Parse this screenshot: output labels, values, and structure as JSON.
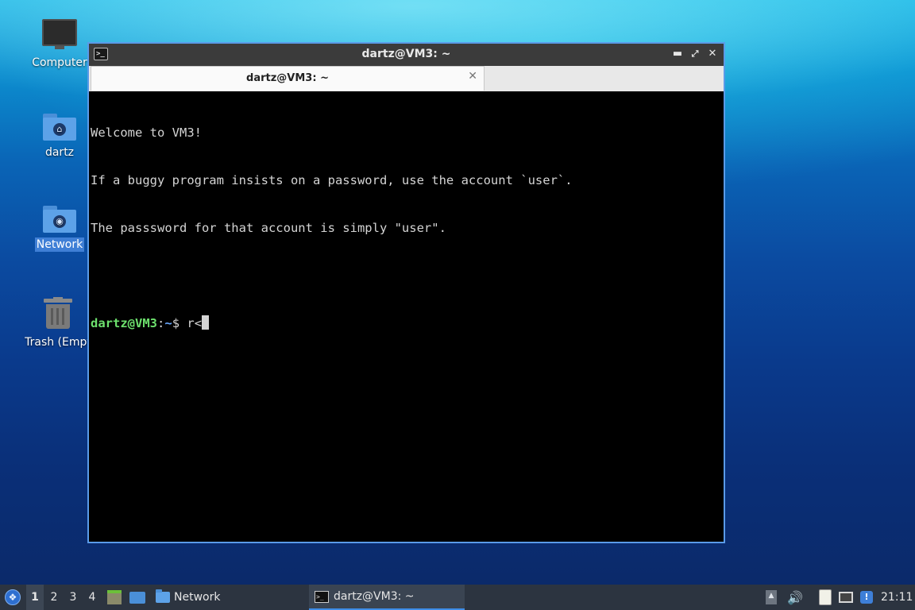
{
  "desktop": {
    "icons": [
      {
        "label": "Computer",
        "icon": "computer-icon"
      },
      {
        "label": "dartz",
        "icon": "home-folder-icon"
      },
      {
        "label": "Network",
        "icon": "network-folder-icon",
        "selected": true
      },
      {
        "label": "Trash (Empt",
        "icon": "trash-icon"
      }
    ]
  },
  "terminal": {
    "window_title": "dartz@VM3: ~",
    "tab_label": "dartz@VM3: ~",
    "lines": [
      "Welcome to VM3!",
      "If a buggy program insists on a password, use the account `user`.",
      "The passsword for that account is simply \"user\"."
    ],
    "prompt": {
      "user_host": "dartz@VM3",
      "sep": ":",
      "path": "~",
      "symbol": "$ ",
      "input": "r<"
    },
    "colors": {
      "prompt_user": "#6de06d",
      "prompt_path": "#6aa8ff",
      "background": "#000000",
      "text": "#d4d4d4"
    }
  },
  "taskbar": {
    "workspaces": [
      "1",
      "2",
      "3",
      "4"
    ],
    "active_workspace": "1",
    "tasks": [
      {
        "label": "Network",
        "icon": "folder-icon"
      },
      {
        "label": "dartz@VM3: ~",
        "icon": "terminal-icon",
        "active": true
      }
    ],
    "clock": "21:11",
    "accent": "#3e8de8"
  }
}
